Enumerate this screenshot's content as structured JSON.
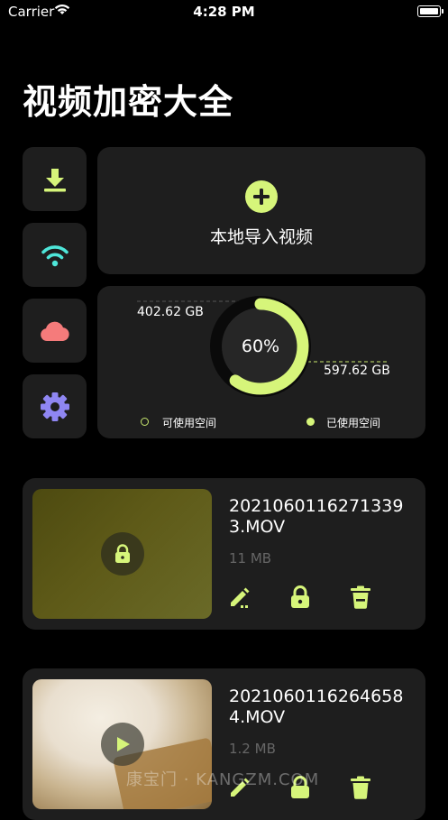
{
  "status_bar": {
    "carrier": "Carrier",
    "time": "4:28 PM"
  },
  "app": {
    "title": "视频加密大全"
  },
  "sidebar": {
    "items": [
      {
        "icon": "download-icon",
        "color": "#d6f57a"
      },
      {
        "icon": "wifi-icon",
        "color": "#4ee6d9"
      },
      {
        "icon": "cloud-icon",
        "color": "#f57b7b"
      },
      {
        "icon": "gear-icon",
        "color": "#8f86f2"
      }
    ]
  },
  "import": {
    "label": "本地导入视频",
    "accent": "#d6f57a"
  },
  "storage": {
    "free_label": "402.62 GB",
    "used_label": "597.62 GB",
    "percent_label": "60%",
    "used_fraction": 0.6,
    "legend_free": "可使用空间",
    "legend_used": "已使用空间"
  },
  "videos": [
    {
      "filename": "20210601162713393.MOV",
      "size": "11 MB",
      "locked": true
    },
    {
      "filename": "20210601162646584.MOV",
      "size": "1.2 MB",
      "locked": false
    }
  ],
  "watermark": "康宝门 · KANGZM.COM"
}
